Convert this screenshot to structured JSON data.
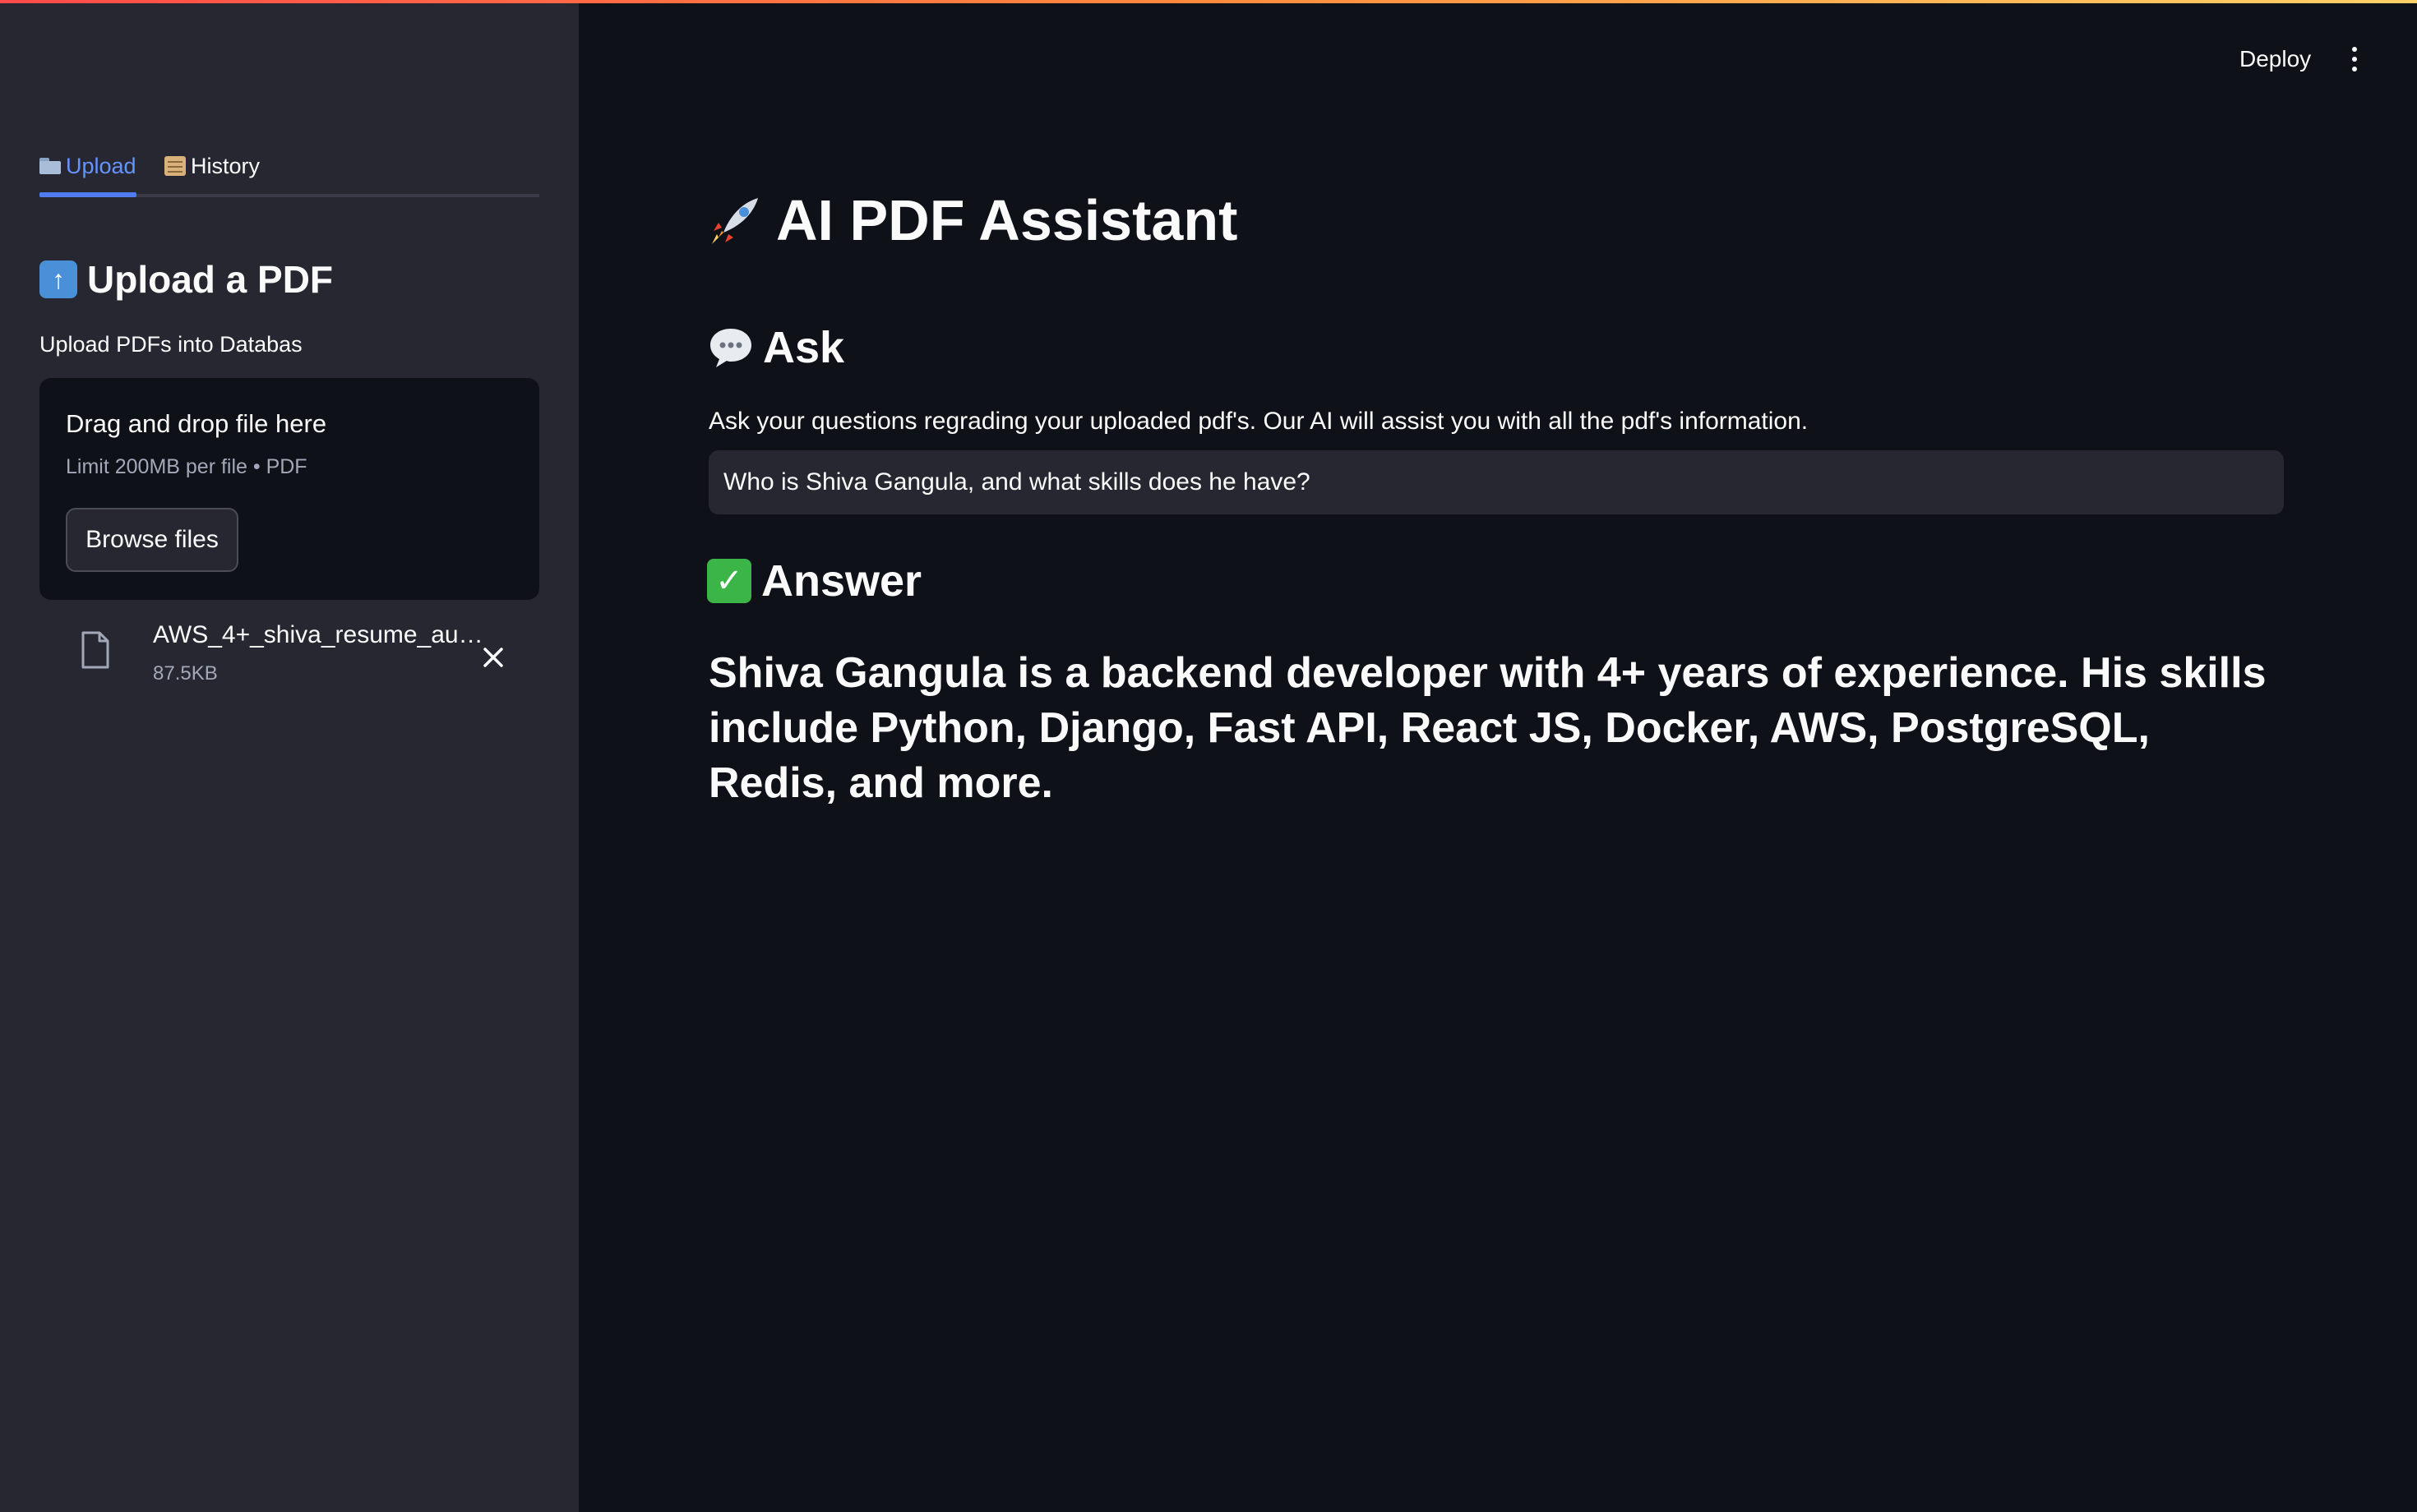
{
  "header": {
    "deploy_label": "Deploy",
    "menu_icon": "vertical-dots-icon"
  },
  "sidebar": {
    "tabs": [
      {
        "label": "Upload",
        "icon": "folder-icon",
        "active": true
      },
      {
        "label": "History",
        "icon": "scroll-icon",
        "active": false
      }
    ],
    "upload_heading": "Upload a PDF",
    "uploader_label": "Upload PDFs into Databas",
    "dropzone": {
      "title": "Drag and drop file here",
      "limit": "Limit 200MB per file • PDF",
      "browse_label": "Browse files"
    },
    "file": {
      "name": "AWS_4+_shiva_resume_au…",
      "size": "87.5KB"
    }
  },
  "main": {
    "title": "AI PDF Assistant",
    "ask_heading": "Ask",
    "ask_description": "Ask your questions regrading your uploaded pdf's. Our AI will assist you with all the pdf's information.",
    "question_value": "Who is Shiva Gangula, and what skills does he have?",
    "answer_heading": "Answer",
    "answer_text": "Shiva Gangula is a backend developer with 4+ years of experience. His skills include Python, Django, Fast API, React JS, Docker, AWS, PostgreSQL, Redis, and more."
  },
  "colors": {
    "accent_tab": "#6495ff",
    "sidebar_bg": "#262730",
    "main_bg": "#0e1117",
    "top_gradient": [
      "#ff4b4b",
      "#ffd16a"
    ]
  }
}
